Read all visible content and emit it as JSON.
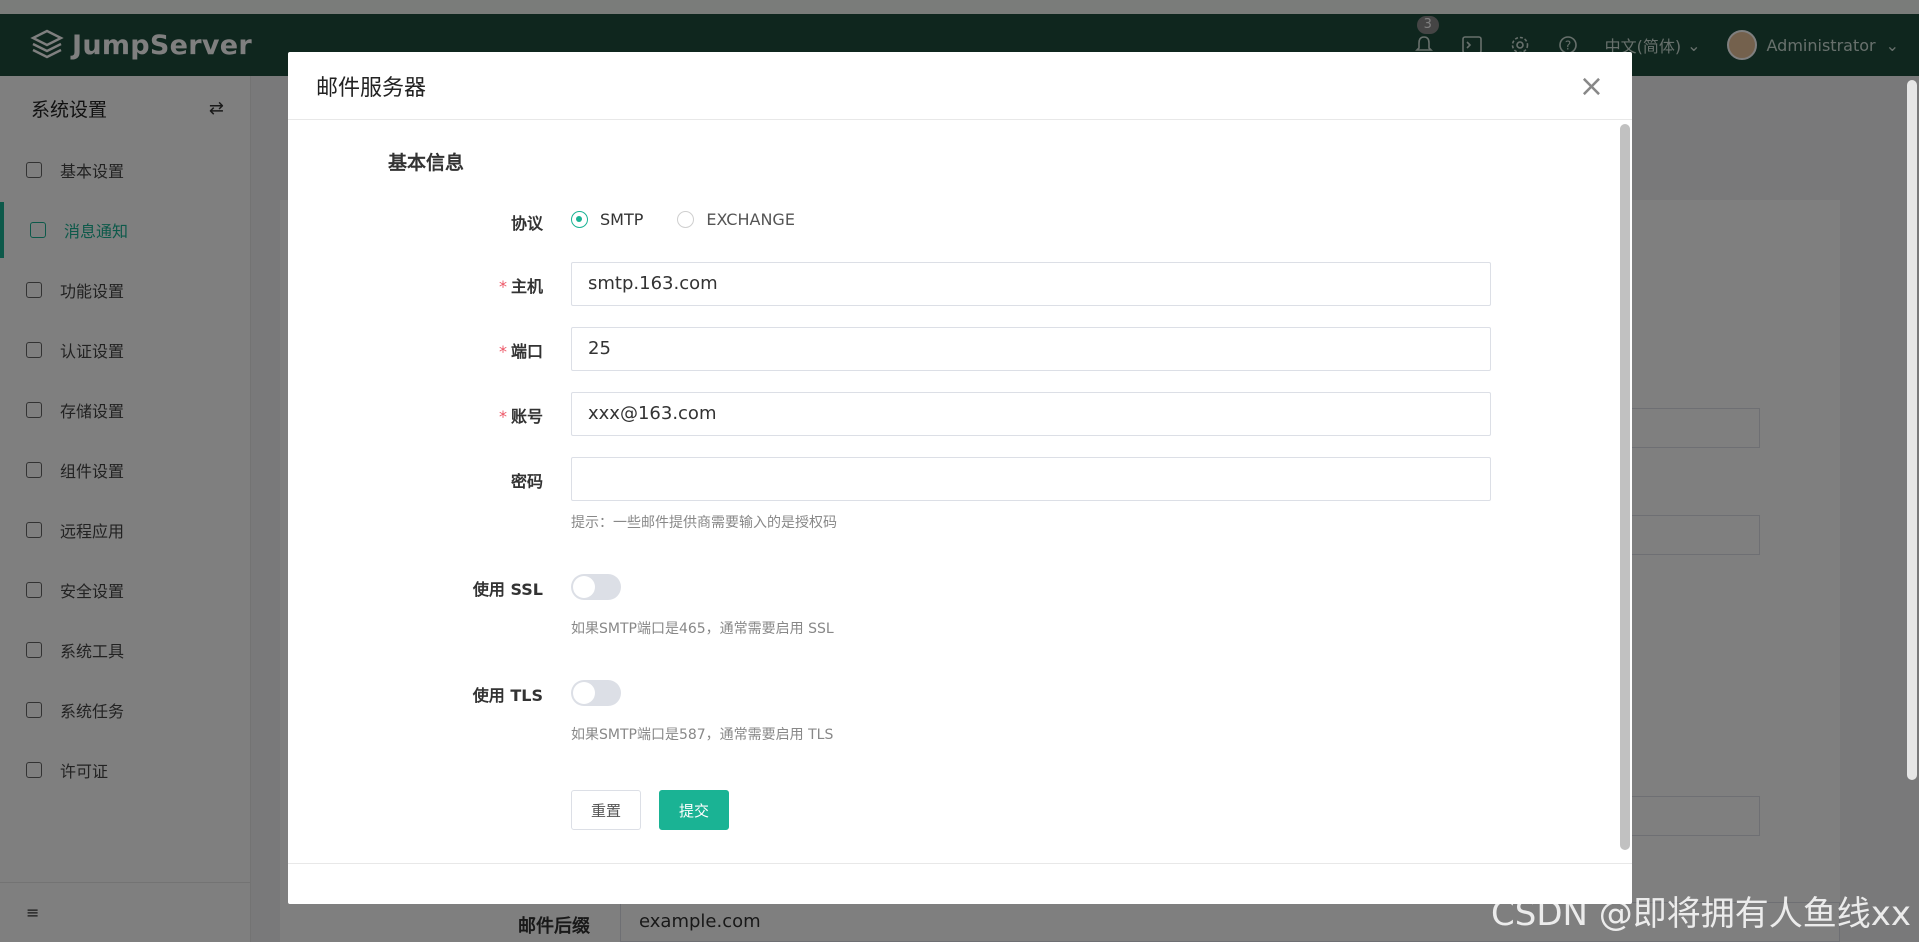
{
  "app": {
    "brand": "JumpServer",
    "notification_count": "3",
    "language": "中文(简体)",
    "user_name": "Administrator"
  },
  "sidebar": {
    "title": "系统设置",
    "items": [
      {
        "label": "基本设置",
        "icon": "grid-icon"
      },
      {
        "label": "消息通知",
        "icon": "mail-icon",
        "active": true
      },
      {
        "label": "功能设置",
        "icon": "cube-icon"
      },
      {
        "label": "认证设置",
        "icon": "id-card-icon"
      },
      {
        "label": "存储设置",
        "icon": "storage-icon"
      },
      {
        "label": "组件设置",
        "icon": "monitor-icon"
      },
      {
        "label": "远程应用",
        "icon": "apps-icon"
      },
      {
        "label": "安全设置",
        "icon": "shield-icon"
      },
      {
        "label": "系统工具",
        "icon": "toolbox-icon"
      },
      {
        "label": "系统任务",
        "icon": "tasks-icon"
      },
      {
        "label": "许可证",
        "icon": "license-icon"
      }
    ]
  },
  "background": {
    "suffix_label": "邮件后缀",
    "suffix_value": "example.com"
  },
  "modal": {
    "title": "邮件服务器",
    "section_title": "基本信息",
    "protocol_label": "协议",
    "protocol_options": [
      "SMTP",
      "EXCHANGE"
    ],
    "protocol_selected": "SMTP",
    "host_label": "主机",
    "host_value": "smtp.163.com",
    "port_label": "端口",
    "port_value": "25",
    "account_label": "账号",
    "account_value": "xxx@163.com",
    "password_label": "密码",
    "password_value": "",
    "password_hint": "提示：一些邮件提供商需要输入的是授权码",
    "ssl_label": "使用 SSL",
    "ssl_on": false,
    "ssl_hint": "如果SMTP端口是465，通常需要启用 SSL",
    "tls_label": "使用 TLS",
    "tls_on": false,
    "tls_hint": "如果SMTP端口是587，通常需要启用 TLS",
    "reset_label": "重置",
    "submit_label": "提交"
  },
  "watermark": "CSDN @即将拥有人鱼线xx",
  "colors": {
    "topbar": "#1f4d3d",
    "accent": "#1ab394",
    "required": "#ed5565"
  }
}
